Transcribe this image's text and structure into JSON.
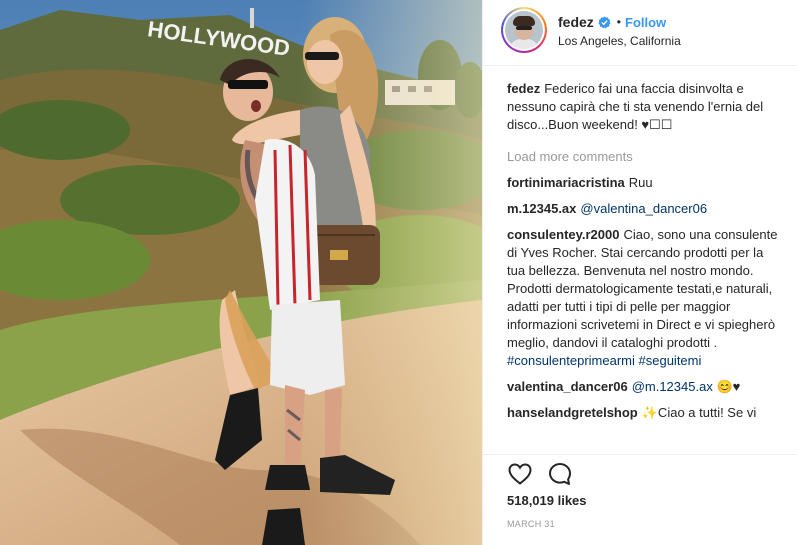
{
  "post": {
    "image_alt": "",
    "sign_text": "HOLLYWOOD"
  },
  "header": {
    "username": "fedez",
    "dot": "•",
    "follow_label": "Follow",
    "location": "Los Angeles, California",
    "verified_icon": "verified-badge-icon"
  },
  "caption": {
    "user": "fedez",
    "text": "Federico fai una faccia disinvolta e nessuno capirà che ti sta venendo l'ernia del disco...Buon weekend! ♥☐☐"
  },
  "load_more_label": "Load more comments",
  "comments": [
    {
      "user": "fortinimariacristina",
      "text": "Ruu",
      "mention": ""
    },
    {
      "user": "m.12345.ax",
      "text": "",
      "mention": "@valentina_dancer06"
    },
    {
      "user": "consulentey.r2000",
      "text": "Ciao, sono una consulente di Yves Rocher. Stai cercando prodotti per la tua bellezza. Benvenuta nel nostro mondo. Prodotti dermatologicamente testati,e naturali, adatti per tutti i tipi di pelle per maggior informazioni scrivetemi in Direct e vi spiegherò meglio, dandovi il cataloghi prodotti .",
      "tags": "#consulenteprimearmi #seguitemi"
    },
    {
      "user": "valentina_dancer06",
      "text": "😊♥",
      "mention": "@m.12345.ax"
    },
    {
      "user": "hanselandgretelshop",
      "text": "✨Ciao a tutti! Se vi",
      "mention": ""
    }
  ],
  "actions": {
    "like_icon": "heart-icon",
    "comment_icon": "comment-icon",
    "likes_label": "518,019 likes",
    "date_label": "MARCH 31"
  },
  "colors": {
    "accent": "#3897f0",
    "mention": "#003569",
    "muted": "#999999",
    "border": "#efefef"
  }
}
